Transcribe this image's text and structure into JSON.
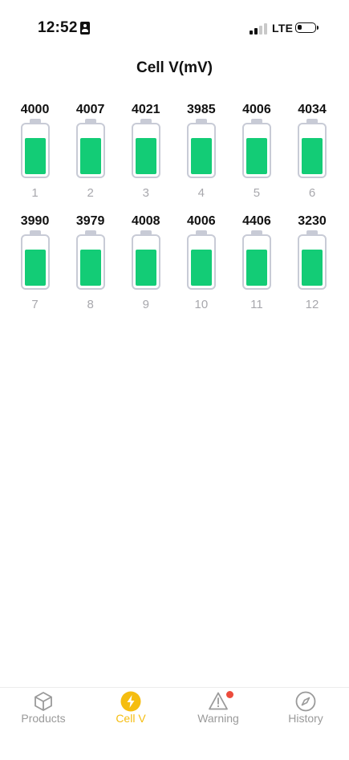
{
  "status_bar": {
    "time": "12:52",
    "network": "LTE",
    "signal_bars_active": 2,
    "signal_bars_total": 4,
    "battery_level": 0.25
  },
  "page": {
    "title": "Cell V(mV)"
  },
  "cells": [
    {
      "index": "1",
      "voltage": "4000",
      "fill": 0.78
    },
    {
      "index": "2",
      "voltage": "4007",
      "fill": 0.78
    },
    {
      "index": "3",
      "voltage": "4021",
      "fill": 0.78
    },
    {
      "index": "4",
      "voltage": "3985",
      "fill": 0.78
    },
    {
      "index": "5",
      "voltage": "4006",
      "fill": 0.78
    },
    {
      "index": "6",
      "voltage": "4034",
      "fill": 0.78
    },
    {
      "index": "7",
      "voltage": "3990",
      "fill": 0.78
    },
    {
      "index": "8",
      "voltage": "3979",
      "fill": 0.78
    },
    {
      "index": "9",
      "voltage": "4008",
      "fill": 0.78
    },
    {
      "index": "10",
      "voltage": "4006",
      "fill": 0.78
    },
    {
      "index": "11",
      "voltage": "4406",
      "fill": 0.78
    },
    {
      "index": "12",
      "voltage": "3230",
      "fill": 0.78
    }
  ],
  "tabs": [
    {
      "name": "products",
      "label": "Products",
      "icon": "cube-icon",
      "active": false
    },
    {
      "name": "cellv",
      "label": "Cell V",
      "icon": "lightning-bolt-icon",
      "active": true
    },
    {
      "name": "warning",
      "label": "Warning",
      "icon": "warning-triangle-icon",
      "active": false,
      "badge": true
    },
    {
      "name": "history",
      "label": "History",
      "icon": "compass-icon",
      "active": false
    }
  ],
  "colors": {
    "accent": "#f5bd10",
    "battery_fill": "#13cc76",
    "battery_outline": "#c8cbd6",
    "badge": "#ec4b3c",
    "inactive": "#9a9a9a"
  }
}
